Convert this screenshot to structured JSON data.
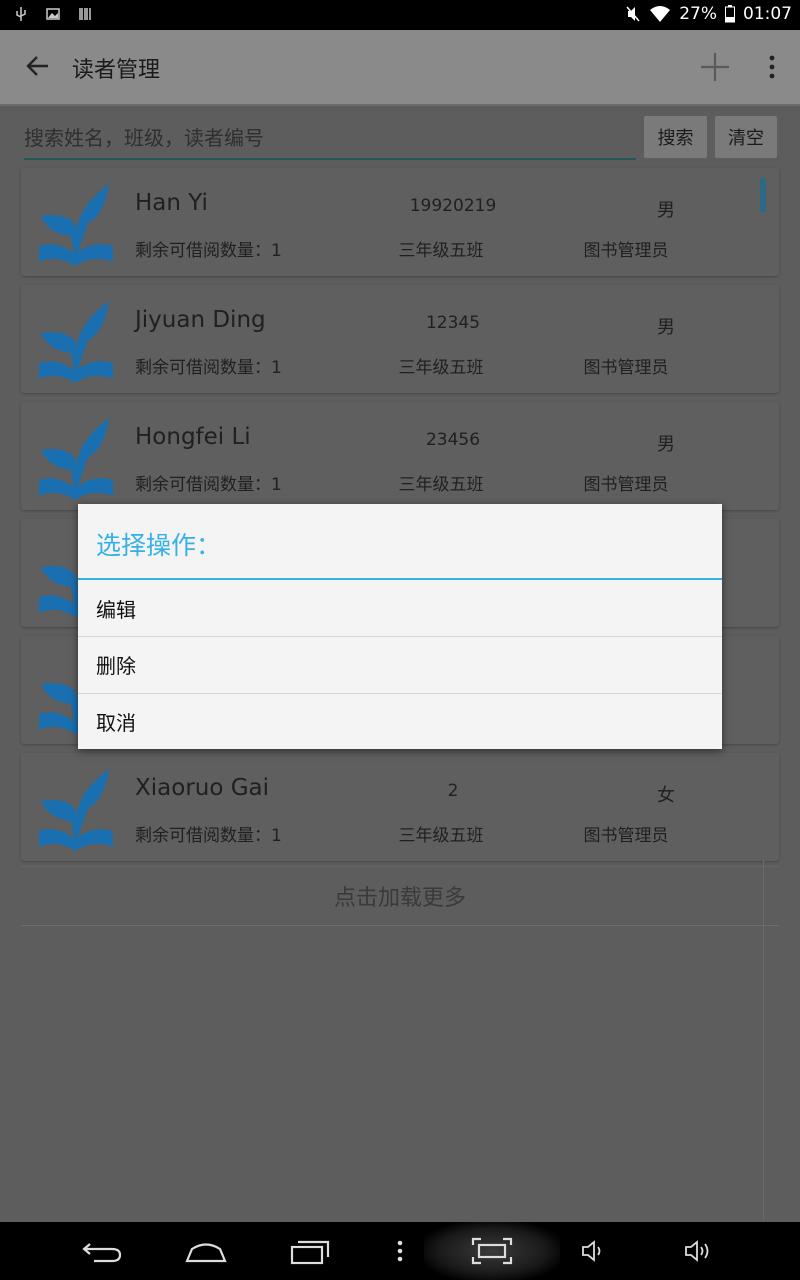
{
  "status_bar": {
    "battery": "27%",
    "time": "01:07",
    "icons": [
      "usb-icon",
      "image-icon",
      "barcode-icon",
      "mute-icon",
      "wifi-icon",
      "battery-icon"
    ]
  },
  "app_bar": {
    "title": "读者管理",
    "icons": [
      "back-arrow-icon",
      "add-icon",
      "overflow-menu-icon"
    ]
  },
  "search": {
    "placeholder": "搜索姓名，班级，读者编号",
    "value": "",
    "search_label": "搜索",
    "clear_label": "清空"
  },
  "readers": [
    {
      "name": "Han Yi",
      "id": "19920219",
      "gender": "男",
      "remaining": "剩余可借阅数量：1",
      "class": "三年级五班",
      "role": "图书管理员"
    },
    {
      "name": "Jiyuan Ding",
      "id": "12345",
      "gender": "男",
      "remaining": "剩余可借阅数量：1",
      "class": "三年级五班",
      "role": "图书管理员"
    },
    {
      "name": "Hongfei Li",
      "id": "23456",
      "gender": "男",
      "remaining": "剩余可借阅数量：1",
      "class": "三年级五班",
      "role": "图书管理员"
    },
    {
      "name": "",
      "id": "",
      "gender": "",
      "remaining": "",
      "class": "",
      "role": ""
    },
    {
      "name": "",
      "id": "",
      "gender": "",
      "remaining": "",
      "class": "",
      "role": ""
    },
    {
      "name": "Xiaoruo Gai",
      "id": "2",
      "gender": "女",
      "remaining": "剩余可借阅数量：1",
      "class": "三年级五班",
      "role": "图书管理员"
    }
  ],
  "load_more": "点击加载更多",
  "dialog": {
    "title": "选择操作：",
    "items": [
      "编辑",
      "删除",
      "取消"
    ]
  },
  "colors": {
    "accent": "#35b1e6",
    "logo_blue": "#1a7fd0",
    "dim_background": "#5d5d5d"
  },
  "nav_bar": {
    "icons": [
      "back-icon",
      "home-icon",
      "recents-icon",
      "menu-dots-icon",
      "screenshot-icon",
      "volume-down-icon",
      "volume-up-icon"
    ]
  }
}
